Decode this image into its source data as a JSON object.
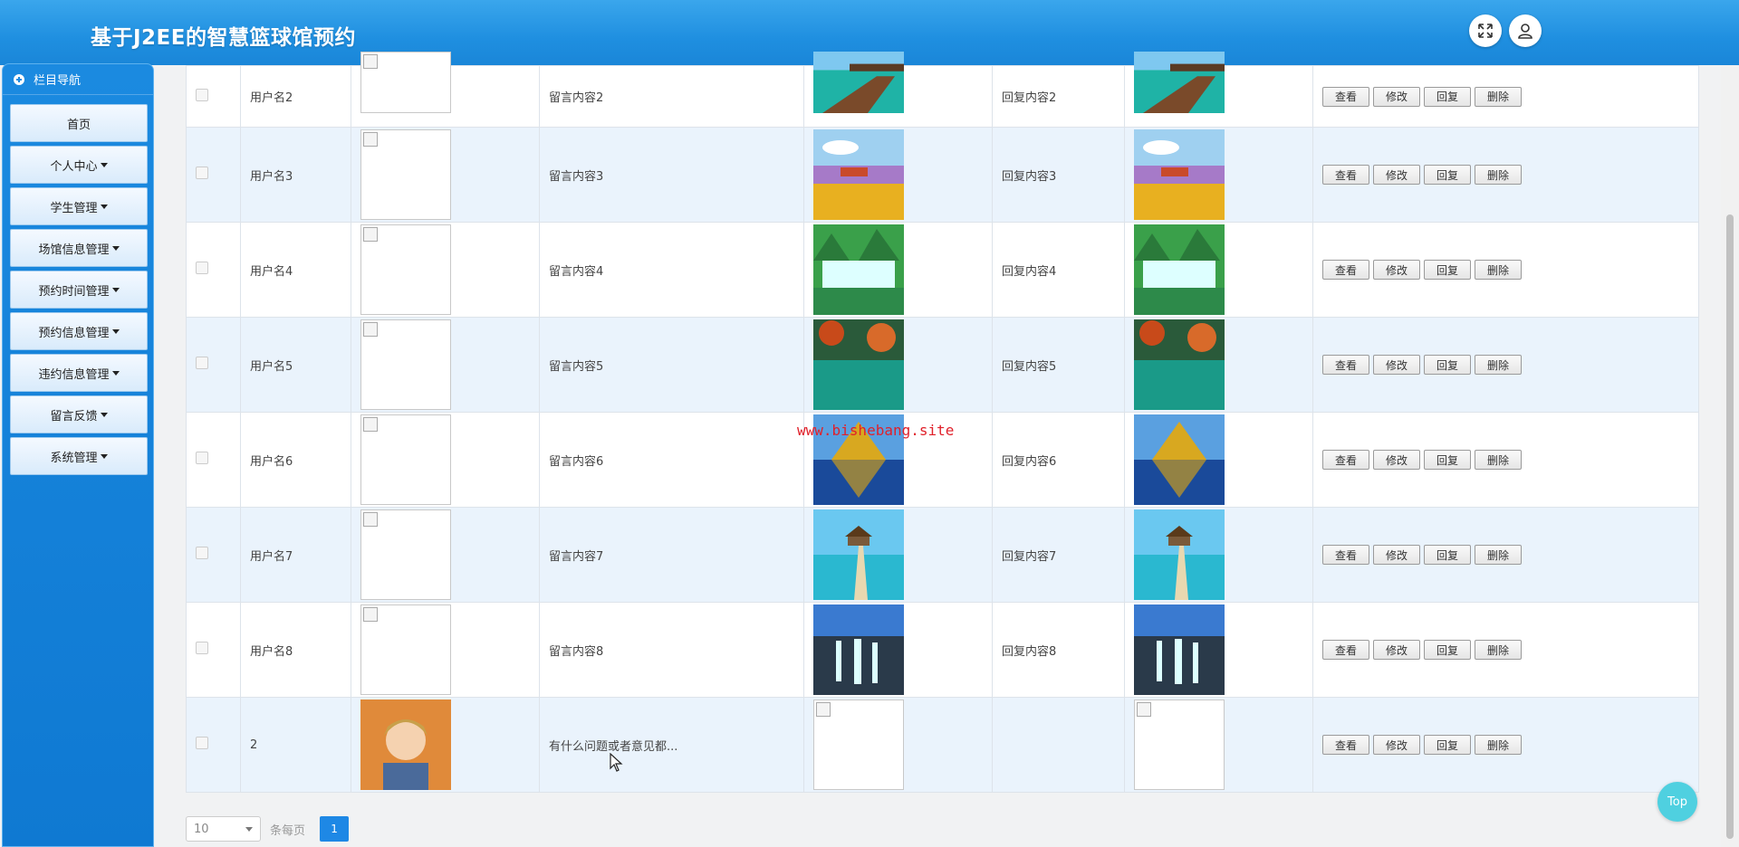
{
  "header": {
    "title": "基于J2EE的智慧篮球馆预约"
  },
  "icons": {
    "fullscreen": "fullscreen-icon",
    "user": "user-icon",
    "nav": "plus-circle-icon"
  },
  "sidebar": {
    "head": "栏目导航",
    "items": [
      {
        "label": "首页",
        "has_caret": false
      },
      {
        "label": "个人中心",
        "has_caret": true
      },
      {
        "label": "学生管理",
        "has_caret": true
      },
      {
        "label": "场馆信息管理",
        "has_caret": true
      },
      {
        "label": "预约时间管理",
        "has_caret": true
      },
      {
        "label": "预约信息管理",
        "has_caret": true
      },
      {
        "label": "违约信息管理",
        "has_caret": true
      },
      {
        "label": "留言反馈",
        "has_caret": true
      },
      {
        "label": "系统管理",
        "has_caret": true
      }
    ]
  },
  "table": {
    "ops": [
      "查看",
      "修改",
      "回复",
      "删除"
    ],
    "rows": [
      {
        "username": "用户名2",
        "content": "留言内容2",
        "reply": "回复内容2",
        "scene": "pier"
      },
      {
        "username": "用户名3",
        "content": "留言内容3",
        "reply": "回复内容3",
        "scene": "field"
      },
      {
        "username": "用户名4",
        "content": "留言内容4",
        "reply": "回复内容4",
        "scene": "waterfall"
      },
      {
        "username": "用户名5",
        "content": "留言内容5",
        "reply": "回复内容5",
        "scene": "lake"
      },
      {
        "username": "用户名6",
        "content": "留言内容6",
        "reply": "回复内容6",
        "scene": "mountain"
      },
      {
        "username": "用户名7",
        "content": "留言内容7",
        "reply": "回复内容7",
        "scene": "beach"
      },
      {
        "username": "用户名8",
        "content": "留言内容8",
        "reply": "回复内容8",
        "scene": "cliff"
      },
      {
        "username": "2",
        "content": "有什么问题或者意见都...",
        "reply": "",
        "scene": "none"
      }
    ]
  },
  "pager": {
    "page_size": "10",
    "per_page_label": "条每页",
    "current_page": "1"
  },
  "watermark": "www.bishebang.site",
  "top_button": "Top"
}
